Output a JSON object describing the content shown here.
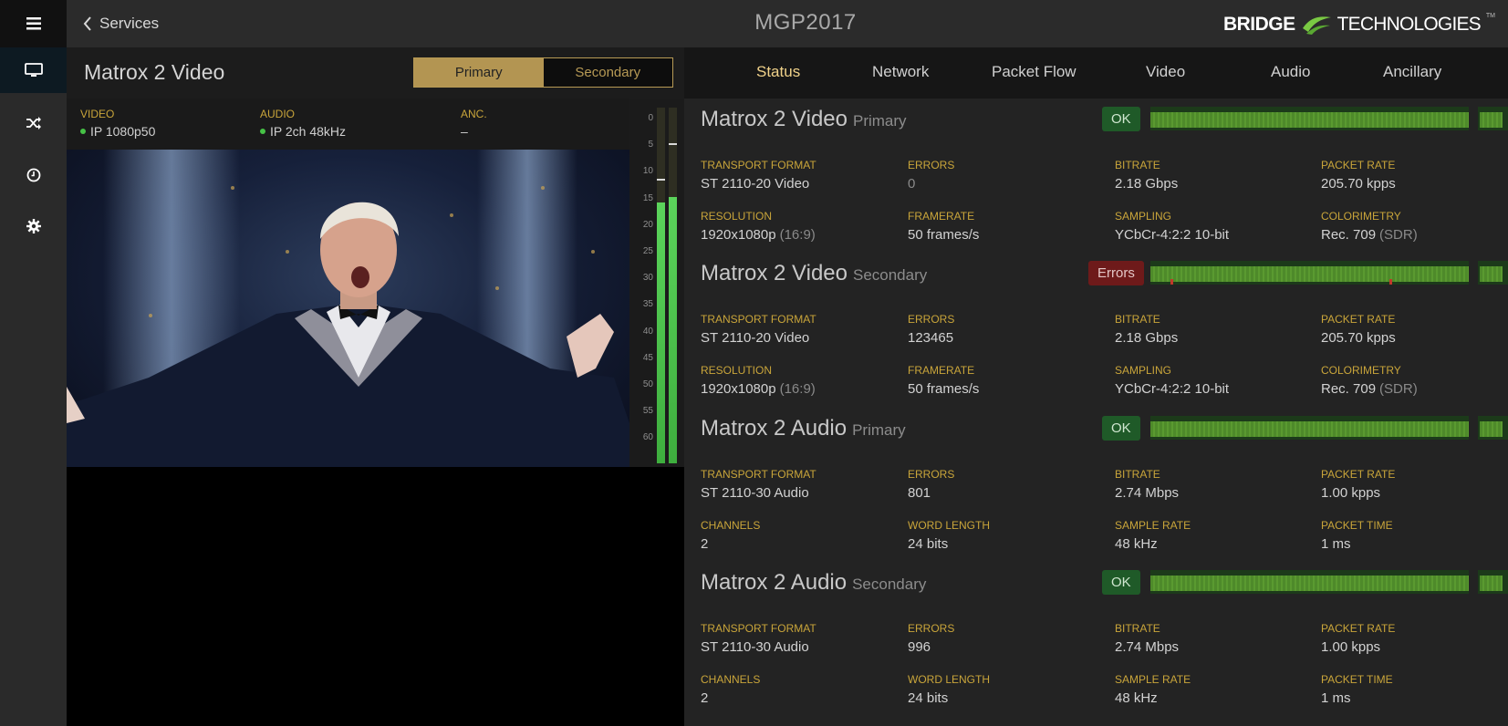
{
  "app": {
    "title": "MGP2017",
    "back_label": "Services",
    "logo_bold": "BRIDGE",
    "logo_light": "TECHNOLOGIES",
    "logo_tm": "TM"
  },
  "rail": {
    "items": [
      {
        "name": "menu",
        "icon": "hamburger-icon"
      },
      {
        "name": "monitor",
        "icon": "monitor-icon",
        "active": true
      },
      {
        "name": "shuffle",
        "icon": "shuffle-icon"
      },
      {
        "name": "clock",
        "icon": "clock-icon"
      },
      {
        "name": "settings",
        "icon": "gear-icon"
      }
    ]
  },
  "left_panel": {
    "service_name": "Matrox 2 Video",
    "toggle": {
      "primary": "Primary",
      "secondary": "Secondary",
      "selected": "Primary"
    },
    "meta": {
      "video_label": "VIDEO",
      "video_value": "IP 1080p50",
      "audio_label": "AUDIO",
      "audio_value": "IP 2ch 48kHz",
      "anc_label": "ANC.",
      "anc_value": "–"
    },
    "meter_ticks": [
      "0",
      "5",
      "10",
      "15",
      "20",
      "25",
      "30",
      "35",
      "40",
      "45",
      "50",
      "55",
      "60"
    ],
    "meter_levels": [
      {
        "channel": 1,
        "level_db": 16,
        "peak_db": 12
      },
      {
        "channel": 2,
        "level_db": 15,
        "peak_db": 6
      }
    ]
  },
  "tabs": {
    "items": [
      "Status",
      "Network",
      "Packet Flow",
      "Video",
      "Audio",
      "Ancillary"
    ],
    "active": "Status"
  },
  "streams": [
    {
      "name": "Matrox 2 Video",
      "sub": "Primary",
      "status": "OK",
      "fields": [
        {
          "label": "TRANSPORT FORMAT",
          "value": "ST 2110-20 Video"
        },
        {
          "label": "ERRORS",
          "value": "0",
          "dim": true
        },
        {
          "label": "BITRATE",
          "value": "2.18 Gbps"
        },
        {
          "label": "PACKET RATE",
          "value": "205.70 kpps"
        },
        {
          "label": "RESOLUTION",
          "value": "1920x1080p",
          "extra": "(16:9)"
        },
        {
          "label": "FRAMERATE",
          "value": "50 frames/s"
        },
        {
          "label": "SAMPLING",
          "value": "YCbCr-4:2:2 10-bit"
        },
        {
          "label": "COLORIMETRY",
          "value": "Rec. 709",
          "extra": "(SDR)"
        }
      ]
    },
    {
      "name": "Matrox 2 Video",
      "sub": "Secondary",
      "status": "Errors",
      "fields": [
        {
          "label": "TRANSPORT FORMAT",
          "value": "ST 2110-20 Video"
        },
        {
          "label": "ERRORS",
          "value": "123465"
        },
        {
          "label": "BITRATE",
          "value": "2.18 Gbps"
        },
        {
          "label": "PACKET RATE",
          "value": "205.70 kpps"
        },
        {
          "label": "RESOLUTION",
          "value": "1920x1080p",
          "extra": "(16:9)"
        },
        {
          "label": "FRAMERATE",
          "value": "50 frames/s"
        },
        {
          "label": "SAMPLING",
          "value": "YCbCr-4:2:2 10-bit"
        },
        {
          "label": "COLORIMETRY",
          "value": "Rec. 709",
          "extra": "(SDR)"
        }
      ]
    },
    {
      "name": "Matrox 2 Audio",
      "sub": "Primary",
      "status": "OK",
      "fields": [
        {
          "label": "TRANSPORT FORMAT",
          "value": "ST 2110-30 Audio"
        },
        {
          "label": "ERRORS",
          "value": "801"
        },
        {
          "label": "BITRATE",
          "value": "2.74 Mbps"
        },
        {
          "label": "PACKET RATE",
          "value": "1.00 kpps"
        },
        {
          "label": "CHANNELS",
          "value": "2"
        },
        {
          "label": "WORD LENGTH",
          "value": "24 bits"
        },
        {
          "label": "SAMPLE RATE",
          "value": "48 kHz"
        },
        {
          "label": "PACKET TIME",
          "value": "1 ms"
        }
      ]
    },
    {
      "name": "Matrox 2 Audio",
      "sub": "Secondary",
      "status": "OK",
      "fields": [
        {
          "label": "TRANSPORT FORMAT",
          "value": "ST 2110-30 Audio"
        },
        {
          "label": "ERRORS",
          "value": "996"
        },
        {
          "label": "BITRATE",
          "value": "2.74 Mbps"
        },
        {
          "label": "PACKET RATE",
          "value": "1.00 kpps"
        },
        {
          "label": "CHANNELS",
          "value": "2"
        },
        {
          "label": "WORD LENGTH",
          "value": "24 bits"
        },
        {
          "label": "SAMPLE RATE",
          "value": "48 kHz"
        },
        {
          "label": "PACKET TIME",
          "value": "1 ms"
        }
      ]
    }
  ],
  "colors": {
    "accent_gold": "#c9a53a",
    "ok_green": "#1f5a28",
    "error_red": "#6e1a1a",
    "logo_green": "#7ac943"
  }
}
